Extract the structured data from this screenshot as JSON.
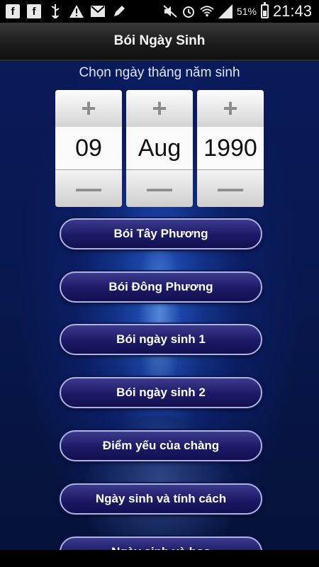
{
  "status_bar": {
    "icons_left": [
      "facebook-icon",
      "facebook-icon",
      "usb-icon",
      "warning-icon",
      "gmail-icon",
      "pen-icon"
    ],
    "icons_right": [
      "mute-icon",
      "alarm-icon",
      "wifi-icon",
      "signal-icon"
    ],
    "battery_pct": "51%",
    "battery_level": 0.51,
    "time": "21:43"
  },
  "header": {
    "title": "Bói Ngày Sinh"
  },
  "main": {
    "subtitle": "Chọn ngày tháng năm sinh",
    "date_picker": {
      "day": "09",
      "month": "Aug",
      "year": "1990",
      "plus_symbol": "+",
      "minus_symbol": "—"
    },
    "menu": [
      "Bói Tây Phương",
      "Bói Đông Phương",
      "Bói ngày sinh 1",
      "Bói ngày sinh 2",
      "Điểm yếu của chàng",
      "Ngày sinh và tính cách",
      "Ngày sinh và hoa"
    ]
  },
  "colors": {
    "accent": "#1c1a66",
    "button_border": "#a8b4e8",
    "background": "#081850"
  }
}
